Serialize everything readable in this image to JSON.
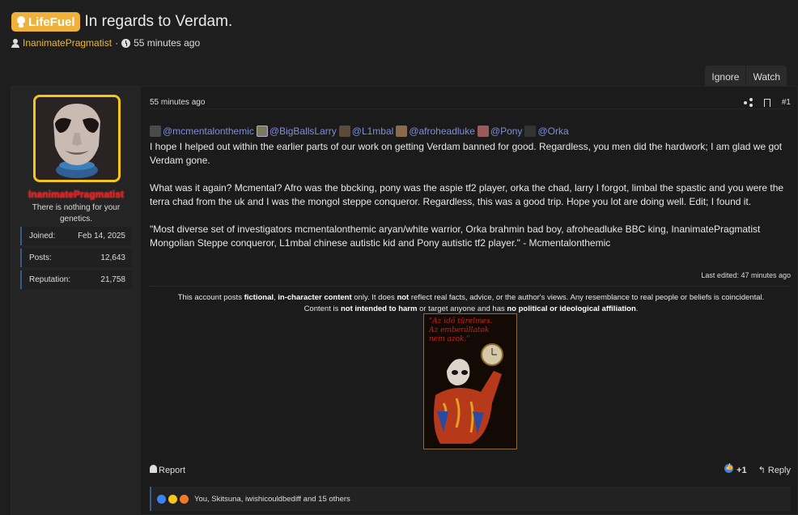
{
  "thread": {
    "label": "LifeFuel",
    "title": "In regards to Verdam.",
    "author": "InanimatePragmatist",
    "separator": "·",
    "posted_ago": "55 minutes ago"
  },
  "actions": {
    "ignore": "Ignore",
    "watch": "Watch"
  },
  "user": {
    "name": "InanimatePragmatist",
    "title": "There is nothing for your genetics.",
    "stats": [
      {
        "label": "Joined:",
        "value": "Feb 14, 2025"
      },
      {
        "label": "Posts:",
        "value": "12,643"
      },
      {
        "label": "Reputation:",
        "value": "21,758"
      }
    ],
    "name_color": "#e02020",
    "avatar_border_color": "#f5c518"
  },
  "post": {
    "time": "55 minutes ago",
    "number": "#1",
    "mentions": [
      "@mcmentalonthemic",
      "@BigBallsLarry",
      "@L1mbal",
      "@afroheadluke",
      "@Pony",
      "@Orka"
    ],
    "paragraphs": [
      "I hope I helped out within the earlier parts of our work on getting Verdam banned for good. Regardless, you men did the hardwork; I am glad we got Verdam gone.",
      "What was it again? Mcmental? Afro was the bbcking, pony was the aspie tf2 player, orka the chad, larry I forgot, limbal the spastic and you were the terra chad from the uk and I was the mongol steppe conqueror. Regardless, this was a good trip. Hope you lot are doing well. Edit; I found it.",
      "\"Most diverse set of investigators mcmentalonthemic aryan/white warrior, Orka brahmin bad boy, afroheadluke BBC king, InanimatePragmatist Mongolian Steppe conqueror, L1mbal chinese autistic kid and Pony autistic tf2 player.\" - Mcmentalonthemic"
    ],
    "last_edited": "Last edited: 47 minutes ago",
    "mention_color": "#7f8fd8"
  },
  "signature": {
    "d1": "This account posts ",
    "d2": "fictional",
    "d3": ", ",
    "d4": "in-character content",
    "d5": " only. It does ",
    "d6": "not",
    "d7": " reflect real facts, advice, or the author's views. Any resemblance to real people or beliefs is coincidental.",
    "d8": "Content is ",
    "d9": "not intended to harm",
    "d10": " or target anyone and has ",
    "d11": "no political or ideological affiliation",
    "d12": ".",
    "image_caption": [
      "\"Az idő türelmes.",
      "Az emberállatok",
      "nem azok.\""
    ]
  },
  "footer": {
    "report": "Report",
    "like_count": "+1",
    "reply": "Reply",
    "reactions_text": "You, Skitsuna, iwishicouldbediff and 15 others"
  }
}
